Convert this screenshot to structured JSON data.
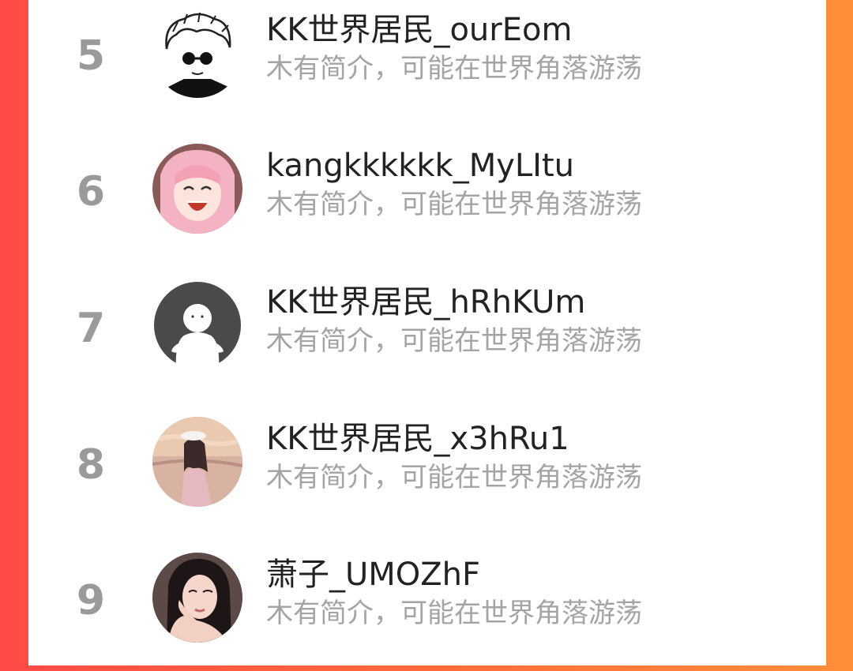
{
  "users": [
    {
      "rank": "5",
      "name": "KK世界居民_ourEom",
      "bio": "木有简介，可能在世界角落游荡",
      "avatar_icon": "cartoon-sunglasses-avatar"
    },
    {
      "rank": "6",
      "name": "kangkkkkkk_MyLItu",
      "bio": "木有简介，可能在世界角落游荡",
      "avatar_icon": "pink-anime-girl-avatar"
    },
    {
      "rank": "7",
      "name": "KK世界居民_hRhKUm",
      "bio": "木有简介，可能在世界角落游荡",
      "avatar_icon": "default-ghost-avatar"
    },
    {
      "rank": "8",
      "name": "KK世界居民_x3hRu1",
      "bio": "木有简介，可能在世界角落游荡",
      "avatar_icon": "sunset-girl-avatar"
    },
    {
      "rank": "9",
      "name": "萧子_UMOZhF",
      "bio": "木有简介，可能在世界角落游荡",
      "avatar_icon": "woman-photo-avatar"
    }
  ],
  "colors": {
    "background_start": "#ff4a47",
    "background_end": "#ff8e3a",
    "rank": "#9a9a9a",
    "name": "#222222",
    "bio": "#a4a4a4"
  }
}
